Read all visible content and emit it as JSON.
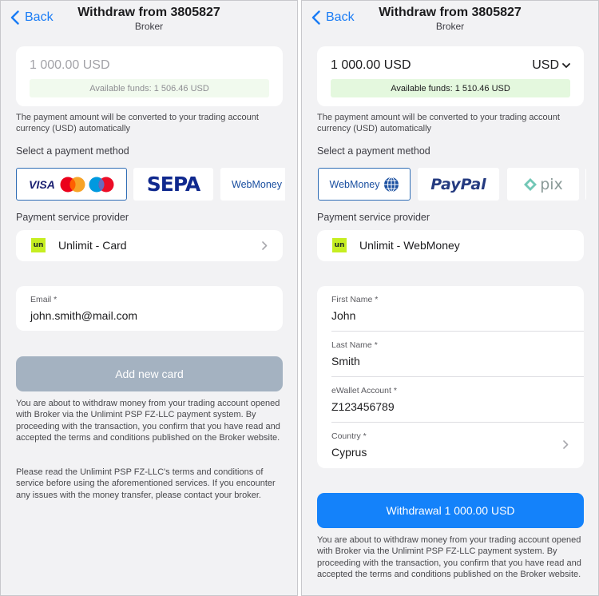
{
  "left": {
    "header": {
      "back_label": "Back",
      "title": "Withdraw from 3805827",
      "subtitle": "Broker"
    },
    "amount": {
      "value": "1 000.00 USD",
      "available": "Available funds: 1 506.46 USD"
    },
    "conversion_note": "The payment amount will be converted to your trading account currency (USD) automatically",
    "payment_method_title": "Select a payment method",
    "payment_methods": [
      {
        "label": "VISA",
        "icon": "visa-mastercard-maestro-logo",
        "selected": true
      },
      {
        "label": "SEPA",
        "icon": "sepa-logo",
        "selected": false
      },
      {
        "label": "WebMoney",
        "icon": "webmoney-logo",
        "selected": false
      }
    ],
    "psp_title": "Payment service provider",
    "psp": {
      "logo_text": "un",
      "name": "Unlimit - Card"
    },
    "email": {
      "label": "Email *",
      "value": "john.smith@mail.com"
    },
    "add_card_label": "Add new card",
    "disclaimer": [
      "You are about to withdraw money from your trading account opened with Broker via the Unlimint PSP FZ-LLC payment system. By proceeding with the transaction, you confirm that you have read and accepted the terms and conditions published on the Broker website.",
      "Please read the Unlimint PSP FZ-LLC's terms and conditions of service before using the aforementioned services. If you encounter any issues with the money transfer, please contact your broker."
    ]
  },
  "right": {
    "header": {
      "back_label": "Back",
      "title": "Withdraw from 3805827",
      "subtitle": "Broker"
    },
    "amount": {
      "value": "1 000.00 USD",
      "currency": "USD",
      "available": "Available funds: 1 510.46 USD"
    },
    "conversion_note": "The payment amount will be converted to your trading account currency (USD) automatically",
    "payment_method_title": "Select a payment method",
    "payment_methods": [
      {
        "label": "WebMoney",
        "icon": "webmoney-logo",
        "selected": true
      },
      {
        "label": "PayPal",
        "icon": "paypal-logo",
        "selected": false
      },
      {
        "label": "pix",
        "icon": "pix-logo",
        "selected": false
      }
    ],
    "psp_title": "Payment service provider",
    "psp": {
      "logo_text": "un",
      "name": "Unlimit - WebMoney"
    },
    "form": {
      "first_name": {
        "label": "First Name *",
        "value": "John"
      },
      "last_name": {
        "label": "Last Name *",
        "value": "Smith"
      },
      "ewallet": {
        "label": "eWallet Account *",
        "value": "Z123456789"
      },
      "country": {
        "label": "Country *",
        "value": "Cyprus"
      }
    },
    "withdraw_label": "Withdrawal 1 000.00 USD",
    "disclaimer": "You are about to withdraw money from your trading account opened with Broker via the Unlimint PSP FZ-LLC payment system. By proceeding with the transaction, you confirm that you have read and accepted the terms and conditions published on the Broker website."
  },
  "colors": {
    "accent": "#1482fa",
    "back_link": "#1a7cf5",
    "disabled_button": "#a4b2c1",
    "funds_bg_left": "#f1faee",
    "funds_bg_right": "#e4f8de",
    "psp_logo_bg": "#c6ee21",
    "screen_bg": "#f2f2f4"
  }
}
